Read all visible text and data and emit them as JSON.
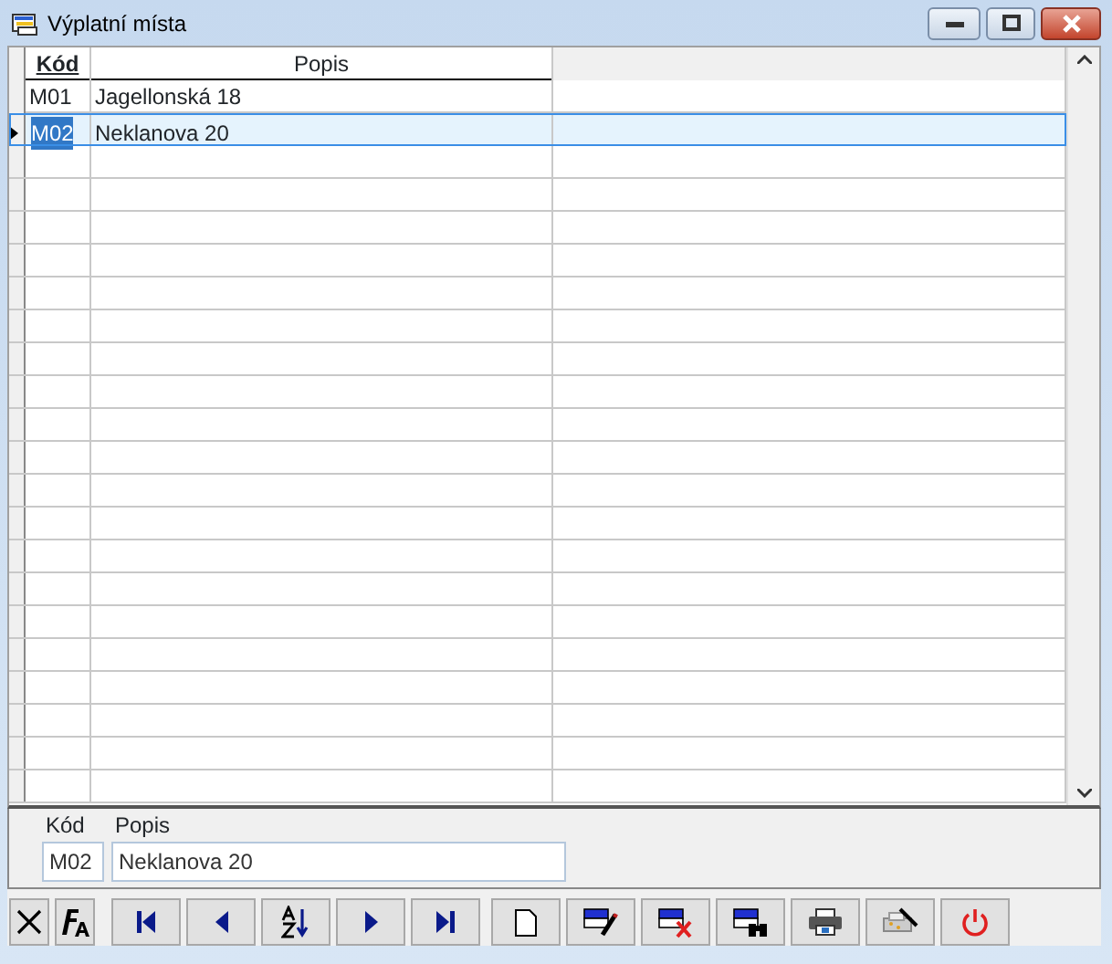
{
  "window": {
    "title": "Výplatní místa"
  },
  "table": {
    "columns": [
      "Kód",
      "Popis"
    ],
    "rows": [
      {
        "code": "M01",
        "description": "Jagellonská 18",
        "selected": false
      },
      {
        "code": "M02",
        "description": "Neklanova 20",
        "selected": true
      }
    ]
  },
  "detail": {
    "code_label": "Kód",
    "description_label": "Popis",
    "code_value": "M02",
    "description_value": "Neklanova 20"
  }
}
